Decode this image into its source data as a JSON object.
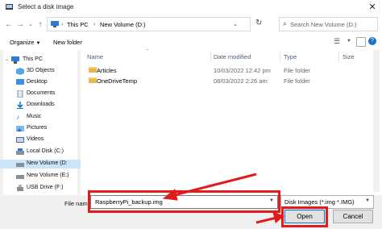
{
  "window": {
    "title": "Select a disk image",
    "close": "✕"
  },
  "address": {
    "path": [
      "This PC",
      "New Volume (D:)"
    ],
    "search_placeholder": "Search New Volume (D:)"
  },
  "toolbar": {
    "organize": "Organize",
    "new_folder": "New folder"
  },
  "nav": {
    "items": [
      {
        "label": "This PC",
        "icon": "pc-icon"
      },
      {
        "label": "3D Objects",
        "icon": "cube-icon"
      },
      {
        "label": "Desktop",
        "icon": "desktop-icon"
      },
      {
        "label": "Documents",
        "icon": "documents-icon"
      },
      {
        "label": "Downloads",
        "icon": "download-icon"
      },
      {
        "label": "Music",
        "icon": "music-icon"
      },
      {
        "label": "Pictures",
        "icon": "pictures-icon"
      },
      {
        "label": "Videos",
        "icon": "videos-icon"
      },
      {
        "label": "Local Disk (C:)",
        "icon": "drive-icon"
      },
      {
        "label": "New Volume (D:",
        "icon": "drive-icon",
        "selected": true
      },
      {
        "label": "New Volume (E:)",
        "icon": "drive-icon"
      },
      {
        "label": "USB Drive (F:)",
        "icon": "usb-drive-icon"
      }
    ]
  },
  "columns": {
    "name": "Name",
    "date": "Date modified",
    "type": "Type",
    "size": "Size"
  },
  "files": [
    {
      "name": "Articles",
      "date": "10/03/2022 12:42 pm",
      "type": "File folder"
    },
    {
      "name": "OneDriveTemp",
      "date": "08/03/2022 2:26 am",
      "type": "File folder"
    }
  ],
  "bottom": {
    "filename_label": "File nam",
    "filename_value": "RaspberryPi_backup.img",
    "filetype_value": "Disk Images (*.img *.IMG)",
    "open_label": "Open",
    "cancel_label": "Cancel"
  },
  "colors": {
    "annotation_red": "#e31b1b",
    "selection_blue": "#cce4f7",
    "folder_yellow": "#e8b64a"
  }
}
